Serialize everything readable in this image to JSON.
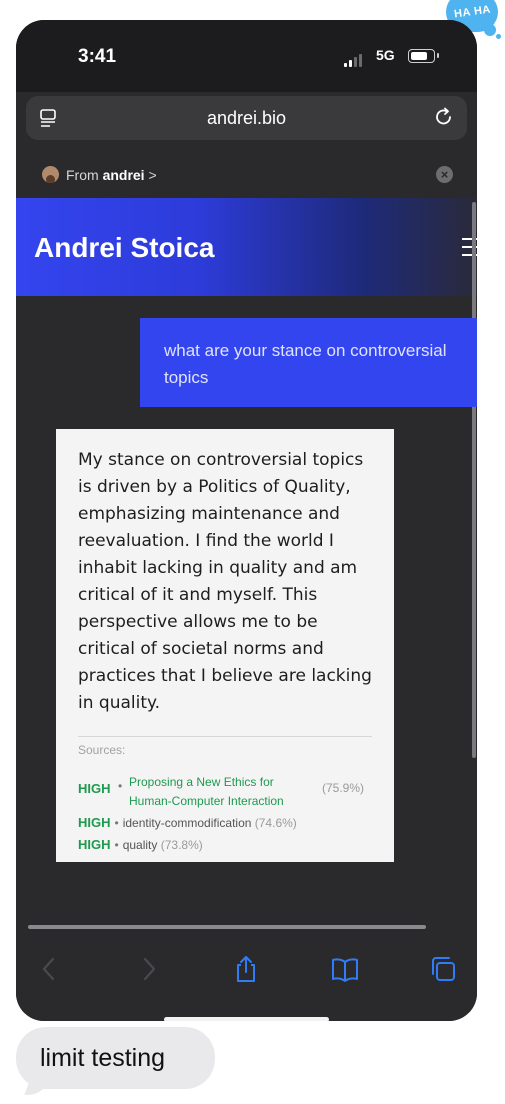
{
  "statusbar": {
    "time": "3:41",
    "network": "5G"
  },
  "browser": {
    "url": "andrei.bio"
  },
  "banner": {
    "from_prefix": "From",
    "from_name": "andrei",
    "chevron": ">"
  },
  "site": {
    "title": "Andrei Stoica"
  },
  "chat": {
    "question": "what are your stance on controversial topics",
    "answer": "My stance on controversial topics is driven by a Politics of Quality, emphasizing maintenance and reevaluation. I find the world I inhabit lacking in quality and am critical of it and myself. This perspective allows me to be critical of societal norms and practices that I believe are lacking in quality.",
    "sources_label": "Sources:",
    "sources": [
      {
        "level": "HIGH",
        "title": "Proposing a New Ethics for Human-Computer Interaction",
        "score": "(75.9%)"
      },
      {
        "level": "HIGH",
        "title": "identity-commodification",
        "score": "(74.6%)"
      },
      {
        "level": "HIGH",
        "title": "quality",
        "score": "(73.8%)"
      }
    ]
  },
  "tapback": {
    "text": "HA HA"
  },
  "message": {
    "text": "limit testing"
  },
  "colors": {
    "accent": "#3345ee",
    "source_high": "#1e9a4e",
    "ios_blue": "#2f7cf6",
    "tapback": "#4fb3f0"
  },
  "icons": [
    "tabs-overview-icon",
    "reload-icon",
    "close-icon",
    "back-icon",
    "forward-icon",
    "share-icon",
    "bookmarks-icon",
    "tabs-icon",
    "hamburger-menu-icon"
  ]
}
